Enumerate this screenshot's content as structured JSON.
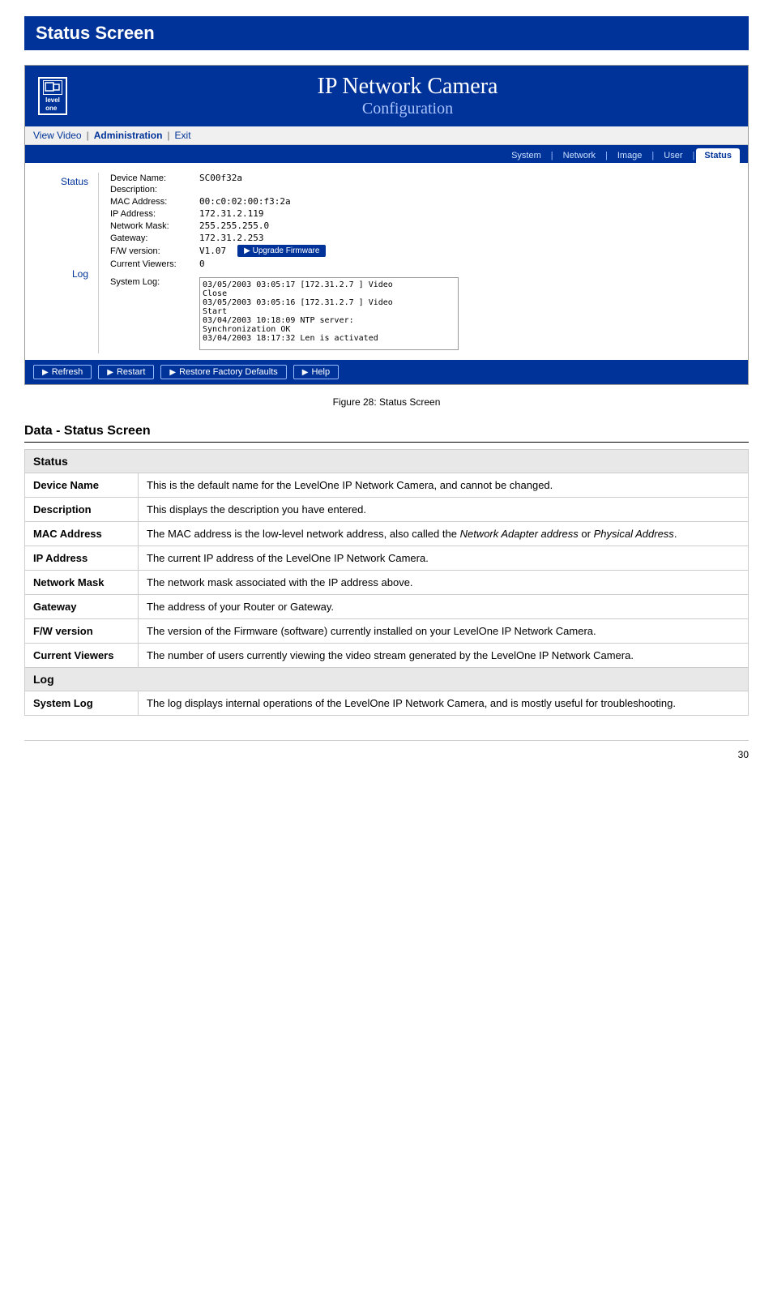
{
  "pageTitle": "Status Screen",
  "camera": {
    "logoText": "level\none",
    "headerTitle": "IP Network Camera",
    "headerSubtitle": "Configuration",
    "nav": {
      "items": [
        "View Video",
        "Administration",
        "Exit"
      ],
      "separators": [
        "|",
        "|"
      ]
    },
    "tabs": [
      "System",
      "Network",
      "Image",
      "User",
      "Status"
    ],
    "activeTab": "Status",
    "sidebar": {
      "statusLabel": "Status",
      "logLabel": "Log"
    },
    "status": {
      "fields": [
        {
          "label": "Device Name:",
          "value": "SC00f32a"
        },
        {
          "label": "Description:",
          "value": ""
        },
        {
          "label": "MAC Address:",
          "value": "00:c0:02:00:f3:2a"
        },
        {
          "label": "IP Address:",
          "value": "172.31.2.119"
        },
        {
          "label": "Network Mask:",
          "value": "255.255.255.0"
        },
        {
          "label": "Gateway:",
          "value": "172.31.2.253"
        },
        {
          "label": "F/W version:",
          "value": "V1.07"
        },
        {
          "label": "Current Viewers:",
          "value": "0"
        }
      ],
      "upgradeFirmwareLabel": "Upgrade Firmware"
    },
    "log": {
      "label": "System Log:",
      "content": "03/05/2003 03:05:17 [172.31.2.7 ] Video\nClose\n03/05/2003 03:05:16 [172.31.2.7 ] Video\nStart\n03/04/2003 10:18:09 NTP server:\nSynchronization OK\n03/04/2003 18:17:32 Len is activated"
    },
    "footer": {
      "buttons": [
        "Refresh",
        "Restart",
        "Restore Factory Defaults",
        "Help"
      ]
    }
  },
  "figureCaption": "Figure 28: Status Screen",
  "dataSection": {
    "title": "Data - Status Screen",
    "sections": [
      {
        "header": "Status",
        "rows": [
          {
            "label": "Device Name",
            "desc": "This is the default name for the LevelOne IP Network Camera, and cannot be changed."
          },
          {
            "label": "Description",
            "desc": "This displays the description you have entered."
          },
          {
            "label": "MAC Address",
            "desc": "The MAC address is the low-level network address, also called the Network Adapter address or Physical Address."
          },
          {
            "label": "IP Address",
            "desc": "The current IP address of the LevelOne IP Network Camera."
          },
          {
            "label": "Network Mask",
            "desc": "The network mask associated with the IP address above."
          },
          {
            "label": "Gateway",
            "desc": "The address of your Router or Gateway."
          },
          {
            "label": "F/W version",
            "desc": "The version of the Firmware (software) currently installed on your LevelOne IP Network Camera."
          },
          {
            "label": "Current Viewers",
            "desc": "The number of users currently viewing the video stream generated by the LevelOne IP Network Camera."
          }
        ]
      },
      {
        "header": "Log",
        "rows": [
          {
            "label": "System Log",
            "desc": "The log displays internal operations of the LevelOne IP Network Camera, and is mostly useful for troubleshooting."
          }
        ]
      }
    ]
  },
  "pageNumber": "30"
}
